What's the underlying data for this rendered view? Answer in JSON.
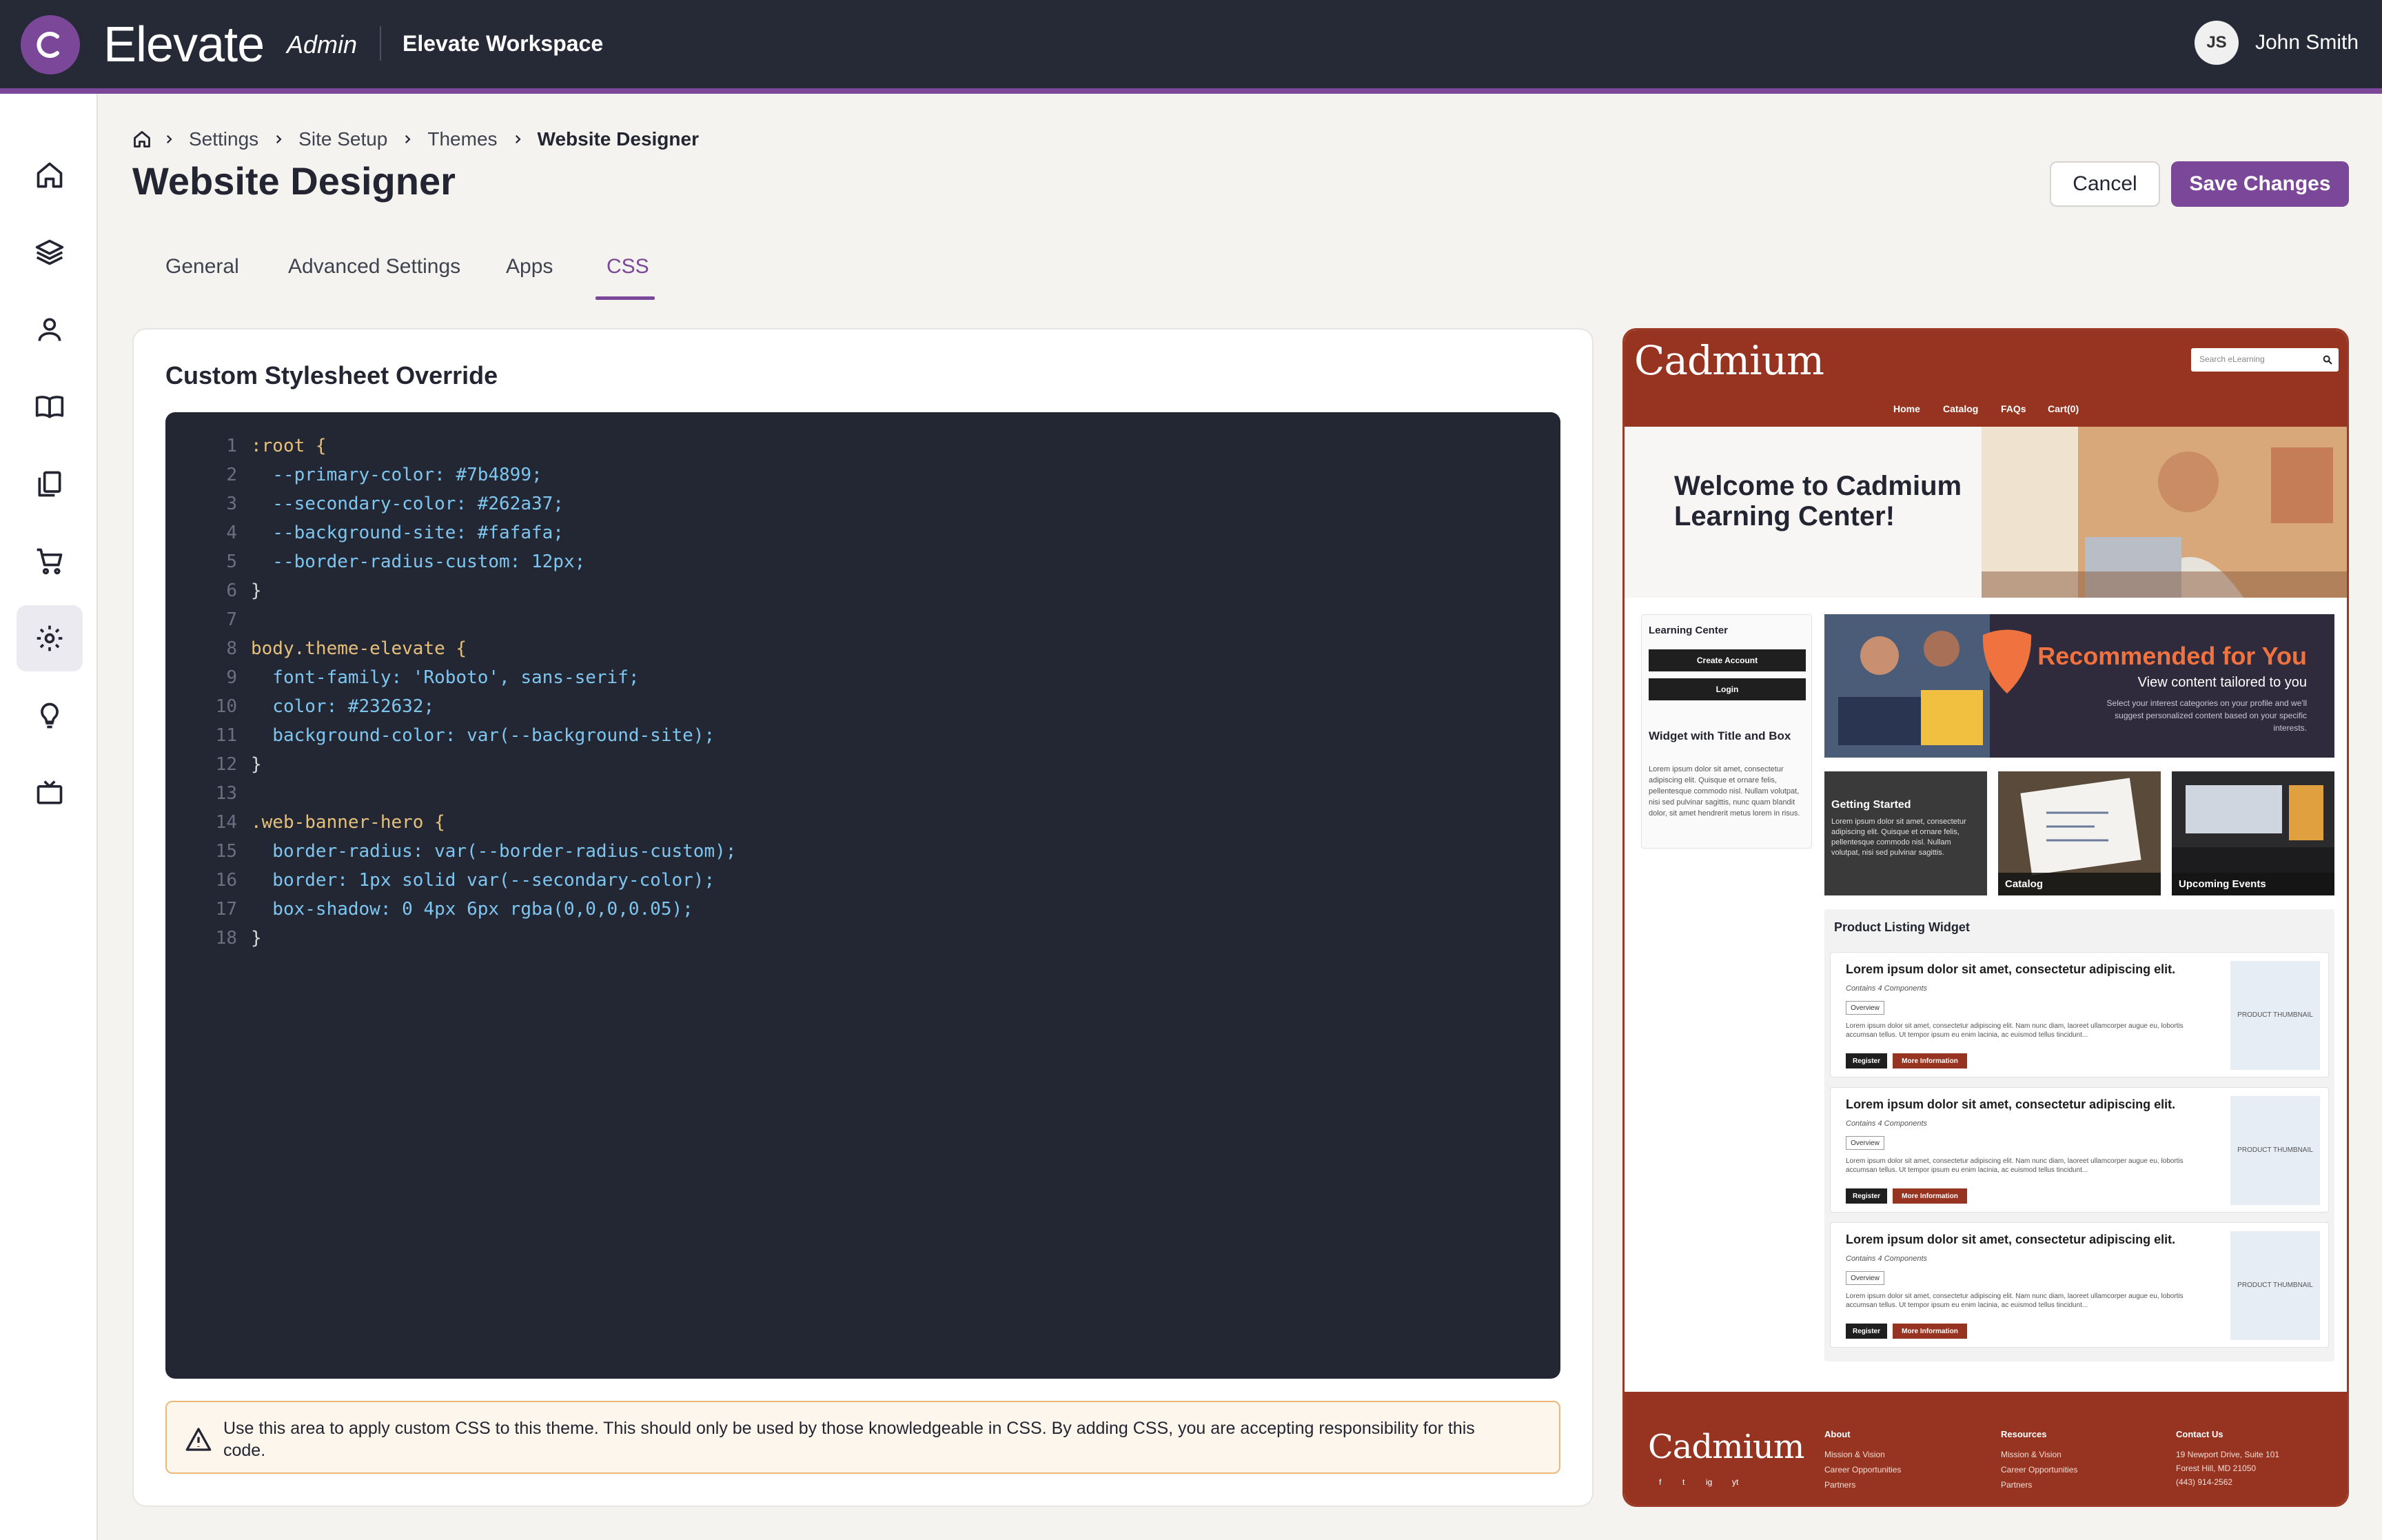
{
  "app": {
    "brand": "Elevate",
    "admin_label": "Admin",
    "workspace": "Elevate Workspace",
    "user_initials": "JS",
    "user_name": "John Smith",
    "primary_color": "#7b4899",
    "secondary_color": "#262a37"
  },
  "sidebar": {
    "items": [
      {
        "icon": "home-icon"
      },
      {
        "icon": "layers-icon"
      },
      {
        "icon": "user-icon"
      },
      {
        "icon": "book-icon"
      },
      {
        "icon": "documents-icon"
      },
      {
        "icon": "cart-icon"
      },
      {
        "icon": "gear-icon",
        "active": true
      },
      {
        "icon": "lightbulb-icon"
      },
      {
        "icon": "tv-icon"
      }
    ]
  },
  "breadcrumb": {
    "items": [
      "Settings",
      "Site Setup",
      "Themes"
    ],
    "current": "Website Designer"
  },
  "page": {
    "title": "Website Designer",
    "cancel_label": "Cancel",
    "save_label": "Save Changes"
  },
  "tabs": [
    {
      "label": "General"
    },
    {
      "label": "Advanced Settings"
    },
    {
      "label": "Apps"
    },
    {
      "label": "CSS",
      "active": true
    }
  ],
  "editor": {
    "heading": "Custom Stylesheet Override",
    "lines": [
      ":root {",
      "  --primary-color: #7b4899;",
      "  --secondary-color: #262a37;",
      "  --background-site: #fafafa;",
      "  --border-radius-custom: 12px;",
      "}",
      "",
      "body.theme-elevate {",
      "  font-family: 'Roboto', sans-serif;",
      "  color: #232632;",
      "  background-color: var(--background-site);",
      "}",
      "",
      ".web-banner-hero {",
      "  border-radius: var(--border-radius-custom);",
      "  border: 1px solid var(--secondary-color);",
      "  box-shadow: 0 4px 6px rgba(0,0,0,0.05);",
      "}"
    ],
    "warning": "Use this area to apply custom CSS to this theme. This should only be used by those knowledgeable in CSS. By adding CSS, you are accepting responsibility for this code."
  },
  "preview": {
    "logo": "Cadmium",
    "search_placeholder": "Search eLearning",
    "nav": [
      "Home",
      "Catalog",
      "FAQs",
      "Cart(0)"
    ],
    "hero_title": "Welcome to Cadmium Learning Center!",
    "side_title": "Learning Center",
    "create_account": "Create Account",
    "login": "Login",
    "widget_title": "Widget with Title and Box",
    "widget_text": "Lorem ipsum dolor sit amet, consectetur adipiscing elit. Quisque et ornare felis, pellentesque commodo nisl. Nullam volutpat, nisi sed pulvinar sagittis, nunc quam blandit dolor, sit amet hendrerit metus lorem in risus.",
    "rec_title": "Recommended for You",
    "rec_sub": "View content tailored to you",
    "rec_desc": "Select your interest categories on your profile and we'll suggest personalized content based on your specific interests.",
    "gs_title": "Getting Started",
    "gs_text": "Lorem ipsum dolor sit amet, consectetur adipiscing elit. Quisque et ornare felis, pellentesque commodo nisl. Nullam volutpat, nisi sed pulvinar sagittis.",
    "catalog_label": "Catalog",
    "events_label": "Upcoming Events",
    "products_title": "Product Listing Widget",
    "product": {
      "title": "Lorem ipsum dolor sit amet, consectetur adipiscing elit.",
      "contains": "Contains 4 Components",
      "overview": "Overview",
      "desc": "Lorem ipsum dolor sit amet, consectetur adipiscing elit. Nam nunc diam, laoreet ullamcorper augue eu, lobortis accumsan tellus. Ut tempor ipsum eu enim lacinia, ac euismod tellus tincidunt...",
      "register": "Register",
      "more": "More Information",
      "thumb": "PRODUCT THUMBNAIL"
    },
    "footer": {
      "logo": "Cadmium",
      "about_title": "About",
      "about": [
        "Mission & Vision",
        "Career Opportunities",
        "Partners"
      ],
      "resources_title": "Resources",
      "resources": [
        "Mission & Vision",
        "Career Opportunities",
        "Partners"
      ],
      "contact_title": "Contact Us",
      "contact": [
        "19 Newport Drive, Suite 101",
        "Forest Hill, MD 21050",
        "(443) 914-2562"
      ],
      "social": [
        "f",
        "t",
        "ig",
        "yt"
      ]
    }
  }
}
